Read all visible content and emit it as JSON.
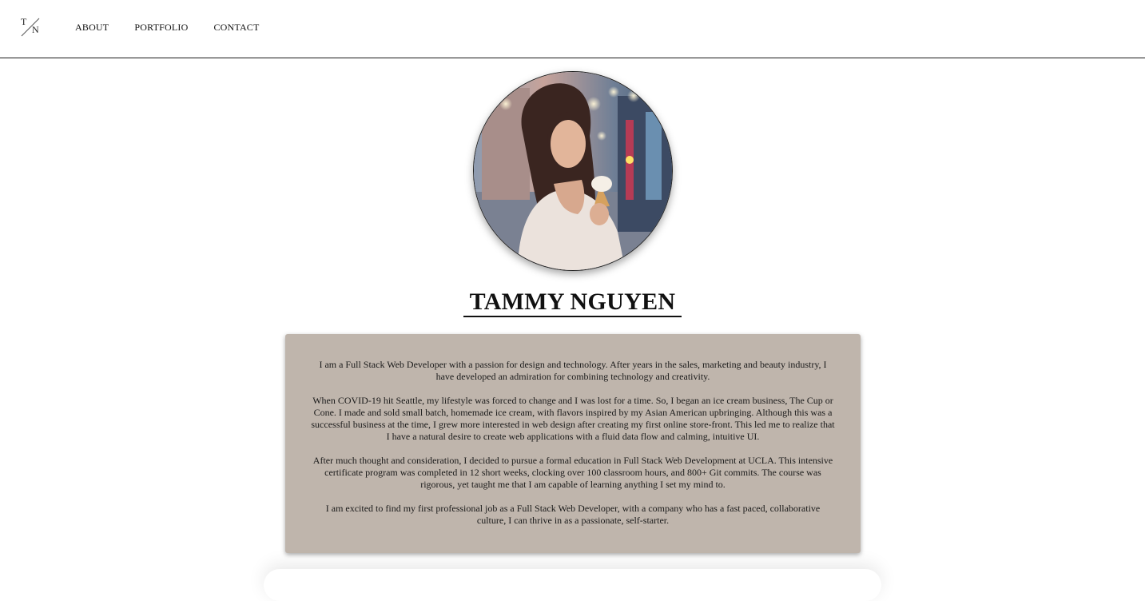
{
  "logo": {
    "letter1": "T",
    "letter2": "N"
  },
  "nav": {
    "items": [
      "ABOUT",
      "PORTFOLIO",
      "CONTACT"
    ]
  },
  "profile": {
    "photo_icon": "profile-photo-woman-ice-cream",
    "name": "TAMMY NGUYEN"
  },
  "about": {
    "paragraphs": [
      "I am a Full Stack Web Developer with a passion for design and technology. After years in the sales, marketing and beauty industry, I have developed an admiration for combining technology and creativity.",
      "When COVID-19 hit Seattle, my lifestyle was forced to change and I was lost for a time. So, I began an ice cream business, The Cup or Cone. I made and sold small batch, homemade ice cream, with flavors inspired by my Asian American upbringing. Although this was a successful business at the time, I grew more interested in web design after creating my first online store-front. This led me to realize that I have a natural desire to create web applications with a fluid data flow and calming, intuitive UI.",
      "After much thought and consideration, I decided to pursue a formal education in Full Stack Web Development at UCLA. This intensive certificate program was completed in 12 short weeks, clocking over 100 classroom hours, and 800+ Git commits. The course was rigorous, yet taught me that I am capable of learning anything I set my mind to.",
      "I am excited to find my first professional job as a Full Stack Web Developer, with a company who has a fast paced, collaborative culture, I can thrive in as a passionate, self-starter."
    ]
  },
  "colors": {
    "about_bg": "#bfb5ac",
    "text": "#111111",
    "border": "#1a1a1a"
  }
}
